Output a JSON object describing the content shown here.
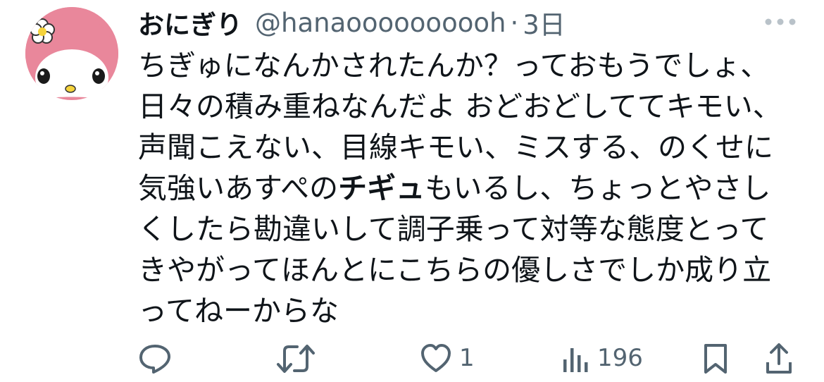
{
  "tweet": {
    "display_name": "おにぎり",
    "handle": "@hanaoooooooooh",
    "separator": "·",
    "time": "3日",
    "avatar_icon": "my-melody-avatar",
    "lines": [
      [
        "ちぎゅになんかされたんか？っておもうでしょ、"
      ],
      [
        "日々の積み重ねなんだよ おどおどしててキモい、"
      ],
      [
        "声聞こえない、目線キモい、ミスする、のくせに"
      ],
      [
        "気強いあすぺの",
        "チギュ",
        "もいるし、ちょっとやさし"
      ],
      [
        "くしたら勘違いして調子乗って対等な態度とって"
      ],
      [
        "きやがってほんとにこちらの優しさでしか成り立"
      ],
      [
        "ってねーからな"
      ]
    ]
  },
  "actions": {
    "reply": {
      "icon": "reply-icon",
      "count": ""
    },
    "retweet": {
      "icon": "retweet-icon",
      "count": ""
    },
    "like": {
      "icon": "heart-icon",
      "count": "1"
    },
    "views": {
      "icon": "views-icon",
      "count": "196"
    },
    "bookmark": {
      "icon": "bookmark-icon"
    },
    "share": {
      "icon": "share-icon"
    }
  },
  "colors": {
    "text": "#0f1419",
    "secondary": "#536471",
    "avatar_bg": "#e9879b"
  }
}
